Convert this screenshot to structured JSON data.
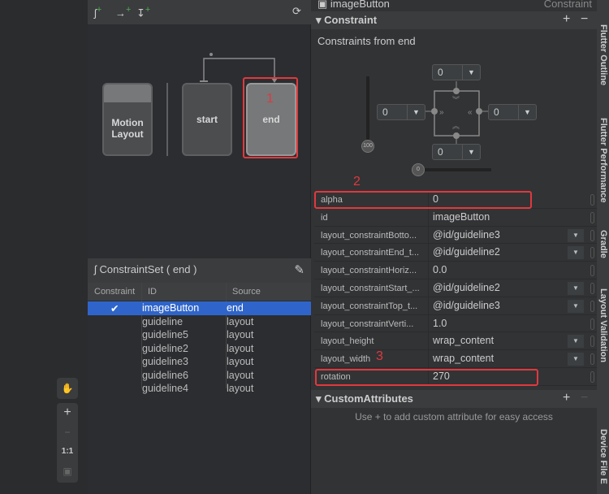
{
  "canvas_tools": {
    "pan": "hand-icon",
    "zoom_in": "+",
    "zoom_out": "−",
    "actual_size": "1:1",
    "fit": "fit-screen-icon"
  },
  "motion_editor": {
    "toolbar_icons": [
      "create-constraintset-icon",
      "create-transition-icon",
      "create-click-handler-icon",
      "cycle-icon"
    ],
    "nodes": {
      "layout": "Motion Layout",
      "start": "start",
      "end": "end"
    },
    "annotation_1": "1"
  },
  "constraint_set": {
    "title": "ConstraintSet ( end )",
    "columns": [
      "Constraint",
      "ID",
      "Source"
    ],
    "rows": [
      {
        "check": "✔",
        "id": "imageButton",
        "source": "end",
        "selected": true
      },
      {
        "check": "",
        "id": "guideline",
        "source": "layout"
      },
      {
        "check": "",
        "id": "guideline5",
        "source": "layout"
      },
      {
        "check": "",
        "id": "guideline2",
        "source": "layout"
      },
      {
        "check": "",
        "id": "guideline3",
        "source": "layout"
      },
      {
        "check": "",
        "id": "guideline6",
        "source": "layout"
      },
      {
        "check": "",
        "id": "guideline4",
        "source": "layout"
      }
    ]
  },
  "attributes": {
    "component": "imageButton",
    "component_type": "Constraint",
    "constraint_section": "Constraint",
    "from_label": "Constraints from end",
    "margins": {
      "top": "0",
      "left": "0",
      "right": "0",
      "bottom": "0"
    },
    "vertical_bias": "100",
    "horizontal_bias": "0",
    "annotation_2": "2",
    "annotation_3": "3",
    "properties": [
      {
        "key": "alpha",
        "value": "0"
      },
      {
        "key": "id",
        "value": "imageButton"
      },
      {
        "key": "layout_constraintBotto...",
        "value": "@id/guideline3",
        "dropdown": true
      },
      {
        "key": "layout_constraintEnd_t...",
        "value": "@id/guideline2",
        "dropdown": true
      },
      {
        "key": "layout_constraintHoriz...",
        "value": "0.0"
      },
      {
        "key": "layout_constraintStart_...",
        "value": "@id/guideline2",
        "dropdown": true
      },
      {
        "key": "layout_constraintTop_t...",
        "value": "@id/guideline3",
        "dropdown": true
      },
      {
        "key": "layout_constraintVerti...",
        "value": "1.0"
      },
      {
        "key": "layout_height",
        "value": "wrap_content",
        "dropdown": true
      },
      {
        "key": "layout_width",
        "value": "wrap_content",
        "dropdown": true
      },
      {
        "key": "rotation",
        "value": "270"
      }
    ],
    "custom_section": "CustomAttributes",
    "custom_hint": "Use + to add custom attribute for easy access",
    "plus": "+",
    "minus": "−"
  },
  "side_tabs": [
    "Flutter Outline",
    "Flutter Performance",
    "Gradle",
    "Layout Validation",
    "Device File E"
  ],
  "colors": {
    "selection": "#2f65ca",
    "highlight": "#e0393e"
  }
}
